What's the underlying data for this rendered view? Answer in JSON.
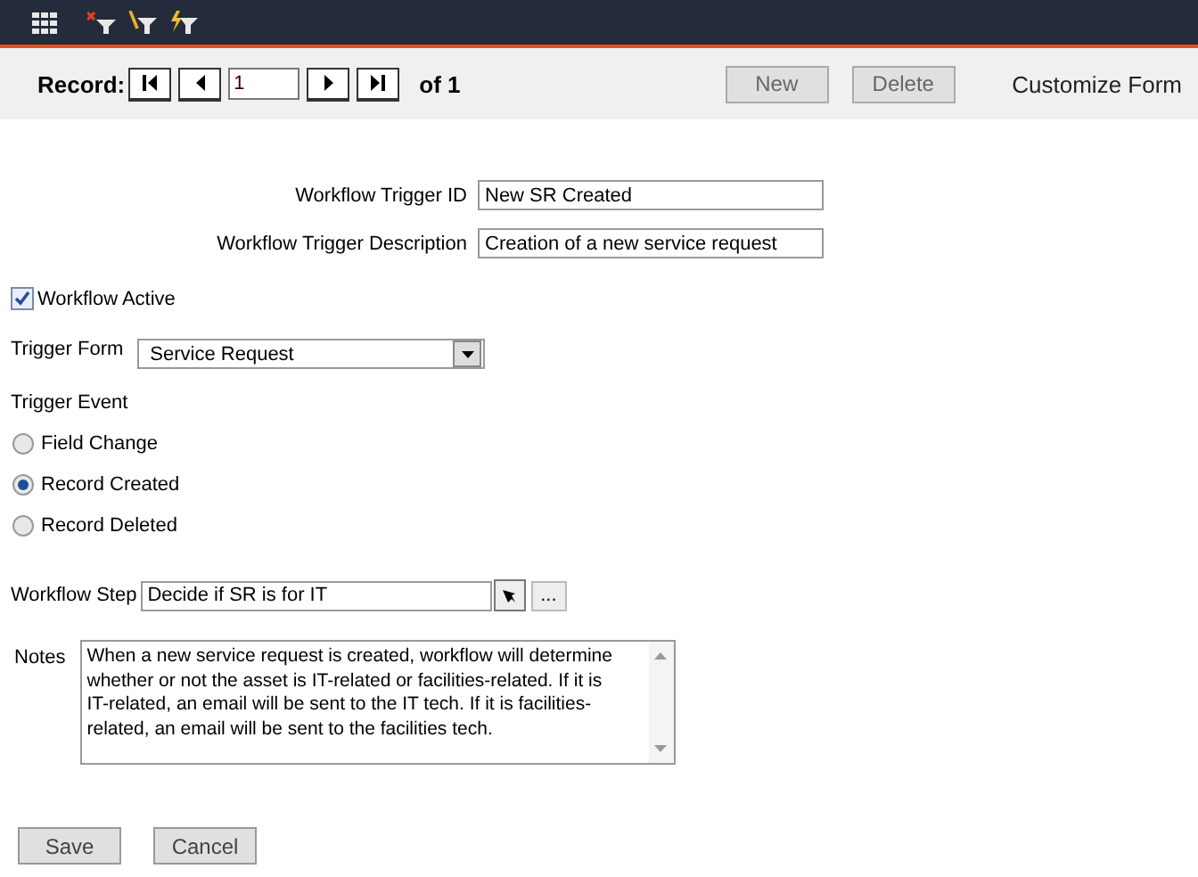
{
  "toolbar": {
    "record_label": "Record:",
    "record_value": "1",
    "record_total": "of 1",
    "buttons": [
      {
        "label": "New",
        "disabled": true
      },
      {
        "label": "Delete",
        "disabled": true
      }
    ],
    "customize_link": "Customize Form"
  },
  "form": {
    "trigger_id": {
      "label": "Workflow Trigger ID",
      "value": "New SR Created"
    },
    "trigger_description": {
      "label": "Workflow Trigger Description",
      "value": "Creation of a new service request"
    },
    "workflow_active": {
      "label": "Workflow Active",
      "checked": true
    },
    "trigger_form": {
      "label": "Trigger Form",
      "value": "Service Request"
    },
    "trigger_event": {
      "label": "Trigger Event",
      "options": [
        {
          "label": "Field Change",
          "selected": false
        },
        {
          "label": "Record Created",
          "selected": true
        },
        {
          "label": "Record Deleted",
          "selected": false
        }
      ]
    },
    "workflow_step": {
      "label": "Workflow Step",
      "value": "Decide if SR is for IT",
      "browse": "..."
    },
    "notes": {
      "label": "Notes",
      "value": "When a new service request is created, workflow will determine whether or not the asset is IT-related or facilities-related. If it is IT-related, an email will be sent to the IT tech. If it is facilities-related, an email will be sent to the facilities tech."
    }
  },
  "actions": [
    "Save",
    "Cancel"
  ]
}
